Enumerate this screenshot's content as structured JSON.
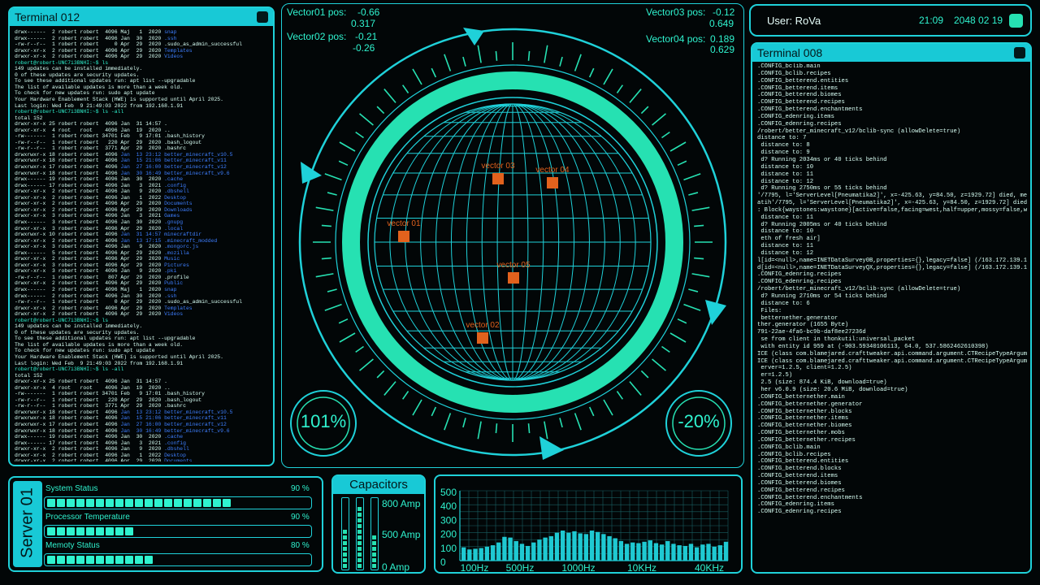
{
  "header": {
    "user": "User: RoVa",
    "time": "21:09",
    "date": "2048 02 19"
  },
  "terminal_left": {
    "title": "Terminal 012"
  },
  "terminal_right": {
    "title": "Terminal 008"
  },
  "vectors": [
    {
      "label": "Vector01 pos:",
      "a": "-0.66",
      "b": "0.317"
    },
    {
      "label": "Vector02 pos:",
      "a": "-0.21",
      "b": "-0.26"
    },
    {
      "label": "Vector03 pos:",
      "a": "-0.12",
      "b": "0.649"
    },
    {
      "label": "Vector04 pos:",
      "a": "0.189",
      "b": "0.629"
    }
  ],
  "globe_markers": [
    "vector 03",
    "vector 04",
    "vector 01",
    "vector 05",
    "vector 02"
  ],
  "gauges": {
    "left": "101%",
    "right": "-20%"
  },
  "server": {
    "title": "Server 01",
    "rows": [
      {
        "label": "System Status",
        "value": "90 %",
        "fraction": 0.9
      },
      {
        "label": "Processor Temperature",
        "value": "90 %",
        "fraction": 0.9
      },
      {
        "label": "Memoty Status",
        "value": "80 %",
        "fraction": 0.8
      }
    ]
  },
  "capacitors": {
    "title": "Capacitors",
    "labels": [
      "800 Amp",
      "500 Amp",
      "0 Amp"
    ],
    "levels": [
      0.55,
      0.95,
      0.5
    ]
  },
  "spectrum": {
    "y_ticks": [
      "500",
      "400",
      "300",
      "200",
      "100",
      "0"
    ],
    "x_ticks": [
      "100Hz",
      "500Hz",
      "1000Hz",
      "10KHz",
      "40KHz"
    ],
    "bars": [
      95,
      80,
      85,
      90,
      100,
      110,
      130,
      170,
      165,
      140,
      120,
      105,
      130,
      150,
      165,
      175,
      200,
      215,
      200,
      210,
      195,
      190,
      215,
      205,
      190,
      175,
      160,
      140,
      120,
      130,
      125,
      135,
      145,
      125,
      115,
      140,
      120,
      110,
      105,
      120,
      95,
      115,
      120,
      100,
      110,
      135
    ]
  },
  "colors": {
    "accent": "#2ff3cf",
    "frame": "#1fd1d9",
    "marker": "#e2621d",
    "background": "#020607"
  },
  "terminal_left_lines": [
    "drwx------  2 robert robert  4096 Maj   1  2020 snap",
    "drwx------  2 robert robert  4096 Jan  30  2020 .ssh",
    "-rw-r--r--  1 robert robert     0 Apr  29  2020 .sudo_as_admin_successful",
    "drwxr-xr-x  2 robert robert  4096 Apr  29  2020 Templates",
    "drwxr-xr-x  2 robert robert  4096 Apr  29  2020 Videos",
    "robert@robert-UNC7i3BNHI:~$ ls",
    "",
    "149 updates can be installed immediately.",
    "0 of these updates are security updates.",
    "To see these additional updates run: apt list --upgradable",
    "",
    "The list of available updates is more than a week old.",
    "To check for new updates run: sudo apt update",
    "Your Hardware Enablement Stack (HWE) is supported until April 2025.",
    "Last login: Wed Feb  9 21:49:03 2022 from 192.168.1.91",
    "robert@robert-UNC7i3BNHI:~$ ls -all",
    "total 152",
    "drwxr-xr-x 25 robert robert  4096 Jan  31 14:57 .",
    "drwxr-xr-x  4 root   root    4096 Jan  19  2020 ..",
    "-rw-------  1 robert robert 34701 Feb   9 17:01 .bash_history",
    "-rw-r--r--  1 robert robert   220 Apr  29  2020 .bash_logout",
    "-rw-r--r--  1 robert robert  3771 Apr  29  2020 .bashrc",
    "drwxrwxr-x 18 robert robert  4096 Jan  13 23:12 better_minecraft_v10.5",
    "drwxrwxr-x 18 robert robert  4096 Jan  15 21:06 better_minecraft_v11",
    "drwxrwxr-x 17 robert robert  4096 Jan  27 16:00 better_minecraft_v12",
    "drwxrwxr-x 18 robert robert  4096 Jan  30 16:49 better_minecraft_v9.6",
    "drwx------ 19 robert robert  4096 Jan  30  2020 .cache",
    "drwx------ 17 robert robert  4096 Jan   3  2021 .config",
    "drwxr-xr-x  2 robert robert  4096 Jan   9  2020 .dbshell",
    "drwxr-xr-x  2 robert robert  4096 Jan   1  2022 Desktop",
    "drwxr-xr-x  2 robert robert  4096 Apr  29  2020 Documents",
    "drwxr-xr-x  2 robert robert  4096 Apr  29  2020 Downloads",
    "drwxr-xr-x  3 robert robert  4096 Jan   3  2021 Games",
    "drwx------  3 robert robert  4096 Jan  30  2020 .gnupg",
    "drwxr-xr-x  3 robert robert  4096 Apr  29  2020 .local",
    "drwxrwxr-x 10 robert robert  4096 Jan  31 14:57 minecraftdir",
    "drwxr-xr-x  2 robert robert  4096 Jan  13 17:15 .minecraft_modded",
    "drwxr-xr-x  3 robert robert  4096 Jan   9  2020 .mongorc.js",
    "drwx------  5 robert robert  4096 Apr  29  2020 .mozilla",
    "drwxr-xr-x  2 robert robert  4096 Apr  29  2020 Music",
    "drwxr-xr-x  3 robert robert  4096 Apr  29  2020 Pictures",
    "drwxr-xr-x  3 robert robert  4096 Jan   9  2020 .pki",
    "-rw-r--r--  1 robert robert   807 Apr  29  2020 .profile",
    "drwxr-xr-x  2 robert robert  4096 Apr  29  2020 Public",
    "drwx------  2 robert robert  4096 Maj   1  2020 snap",
    "drwx------  2 robert robert  4096 Jan  30  2020 .ssh",
    "-rw-r--r--  1 robert robert     0 Apr  29  2020 .sudo_as_admin_successful",
    "drwxr-xr-x  2 robert robert  4096 Apr  29  2020 Templates",
    "drwxr-xr-x  2 robert robert  4096 Apr  29  2020 Videos",
    "robert@robert-UNC7i3BNHI:~$ ls",
    "",
    "149 updates can be installed immediately.",
    "0 of these updates are security updates.",
    "To see these additional updates run: apt list --upgradable",
    "",
    "The list of available updates is more than a week old.",
    "To check for new updates run: sudo apt update",
    "Your Hardware Enablement Stack (HWE) is supported until April 2025.",
    "Last login: Wed Feb  9 21:49:03 2022 from 192.168.1.91",
    "robert@robert-UNC7i3BNHI:~$ ls -all",
    "total 152",
    "drwxr-xr-x 25 robert robert  4096 Jan  31 14:57 .",
    "drwxr-xr-x  4 root   root    4096 Jan  19  2020 ..",
    "-rw-------  1 robert robert 34701 Feb   9 17:01 .bash_history",
    "-rw-r--r--  1 robert robert   220 Apr  29  2020 .bash_logout",
    "-rw-r--r--  1 robert robert  3771 Apr  29  2020 .bashrc",
    "drwxrwxr-x 18 robert robert  4096 Jan  13 23:12 better_minecraft_v10.5",
    "drwxrwxr-x 18 robert robert  4096 Jan  15 21:06 better_minecraft_v11",
    "drwxrwxr-x 17 robert robert  4096 Jan  27 16:00 better_minecraft_v12",
    "drwxrwxr-x 18 robert robert  4096 Jan  30 16:49 better_minecraft_v9.6",
    "drwx------ 19 robert robert  4096 Jan  30  2020 .cache",
    "drwx------ 17 robert robert  4096 Jan   3  2021 .config",
    "drwxr-xr-x  2 robert robert  4096 Jan   9  2020 .dbshell",
    "drwxr-xr-x  2 robert robert  4096 Jan   1  2022 Desktop",
    "drwxr-xr-x  2 robert robert  4096 Apr  29  2020 Documents",
    "drwxr-xr-x  2 robert robert  4096 Apr  29  2020 Downloads",
    "drwxr-xr-x  3 robert robert  4096 Jan   3  2021 Games",
    "drwx------  3 robert robert  4096 Jan  30  2020 .gnupg",
    "drwxr-xr-x  3 robert robert  4096 Apr  29  2020 .local",
    "drwxrwxr-x 10 robert robert  4096 Jan  31 14:57 minecraftdir",
    "drwxr-xr-x  2 robert robert  4096 Jan  13 17:15 .minecraft_modded",
    "drwxr-xr-x  3 robert robert  4096 Jan   9  2020 .mongorc.js",
    "drwx------  5 robert robert  4096 Apr  29  2020 .mozilla",
    "drwxr-xr-x  2 robert robert  4096 Apr  29  2020 Music",
    "drwxr-xr-x  3 robert robert  4096 Apr  29  2020 Pictures",
    "drwxr-xr-x  3 robert robert  4096 Jan   9  2020 .pki",
    "-rw-r--r--  1 robert robert   807 Apr  29  2020 .profile",
    "drwxr-xr-x  2 robert robert  4096 Apr  29  2020 Public",
    "drwx------  2 robert robert  4096 Maj   1  2020 snap"
  ],
  "terminal_right_lines": [
    ".CONFIG_bclib.main",
    ".CONFIG_bclib.recipes",
    ".CONFIG_betterend.entities",
    ".CONFIG_betterend.items",
    ".CONFIG_betterend.biomes",
    ".CONFIG_betterend.recipes",
    ".CONFIG_betterend.enchantments",
    ".CONFIG_edenring.items",
    ".CONFIG_edenring.recipes",
    "/robert/better_minecraft_v12/bclib-sync (allowDelete=true)",
    "distance to: 7",
    " distance to: 8",
    " distance to: 9",
    " d? Running 2034ms or 40 ticks behind",
    " distance to: 10",
    " distance to: 11",
    " distance to: 12",
    " d? Running 2750ms or 55 ticks behind",
    "'/7795, l='ServerLevel[Pneumatika2]', x=-425.63, y=84.50, z=1929.72] died, mess",
    "atih'/7795, l='ServerLevel[Pneumatika2]', x=-425.63, y=84.50, z=1929.72] died:",
    ": Block{waystones:waystone}[active=false,facing=west,half=upper,mossy=false,wate",
    " distance to: 11",
    " d? Running 2005ms or 40 ticks behind",
    " distance to: 10",
    " eth of fresh air]",
    " distance to: 11",
    " distance to: 12",
    "",
    "",
    "l[id=<null>,name=INETDataSurvey0B,properties={},legacy=false] (/163.172.139.143",
    "d[id=<null>,name=INETDataSurveyQX,properties={},legacy=false] (/163.172.139.143",
    ".CONFIG_edenring.recipes",
    ".CONFIG_edenring.recipes",
    "/robert/better_minecraft_v12/bclib-sync (allowDelete=true)",
    " d? Running 2710ms or 54 ticks behind",
    " distance to: 6",
    " Files:",
    " betternether.generator",
    "",
    "ther.generator (1655 Byte)",
    "",
    "",
    "791-22ae-4fa6-bc9b-daf8ee27236d",
    " se from client in thonkutil:universal_packet",
    " with entity id 959 at (-903.59340106113, 64.0, 537.5862462610398)",
    "",
    "",
    "ICE (class com.blamejared.crafttweaker.api.command.argument.CTRecipeTypeArgument",
    "ICE (class com.blamejared.crafttweaker.api.command.argument.CTRecipeTypeArgument",
    " erver=1.2.5, client=1.2.5)",
    " er=1.2.5)",
    " 2.5 (size: 874.4 KiB, download=true)",
    " her v6.0.9 (size: 20.6 MiB, download=true)",
    ".CONFIG_betternether.main",
    ".CONFIG_betternether.generator",
    ".CONFIG_betternether.blocks",
    ".CONFIG_betternether.items",
    ".CONFIG_betternether.biomes",
    ".CONFIG_betternether.mobs",
    ".CONFIG_betternether.recipes",
    ".CONFIG_bclib.main",
    ".CONFIG_bclib.recipes",
    ".CONFIG_betterend.entities",
    ".CONFIG_betterend.blocks",
    ".CONFIG_betterend.items",
    ".CONFIG_betterend.biomes",
    ".CONFIG_betterend.recipes",
    ".CONFIG_betterend.enchantments",
    ".CONFIG_edenring.items",
    ".CONFIG_edenring.recipes"
  ]
}
